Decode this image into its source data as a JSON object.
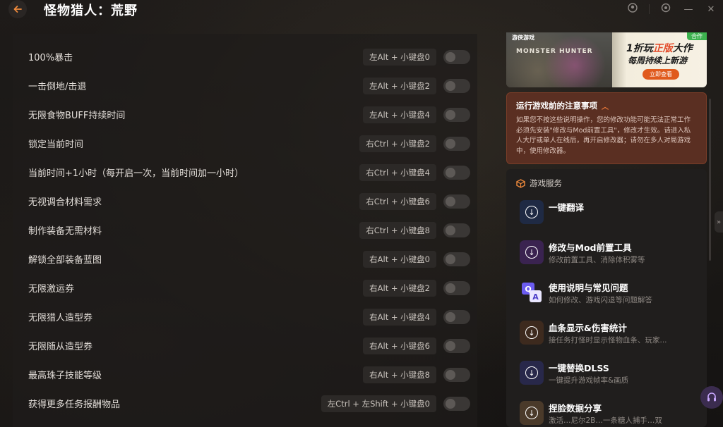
{
  "app": {
    "title": "怪物猎人：荒野"
  },
  "cheats": [
    {
      "label": "100%暴击",
      "hotkey": "左Alt + 小键盘0"
    },
    {
      "label": "一击倒地/击退",
      "hotkey": "左Alt + 小键盘2"
    },
    {
      "label": "无限食物BUFF持续时间",
      "hotkey": "左Alt + 小键盘4"
    },
    {
      "label": "锁定当前时间",
      "hotkey": "右Ctrl + 小键盘2"
    },
    {
      "label": "当前时间+1小时（每开启一次，当前时间加一小时）",
      "hotkey": "右Ctrl + 小键盘4"
    },
    {
      "label": "无视调合材料需求",
      "hotkey": "右Ctrl + 小键盘6"
    },
    {
      "label": "制作装备无需材料",
      "hotkey": "右Ctrl + 小键盘8"
    },
    {
      "label": "解锁全部装备蓝图",
      "hotkey": "右Alt + 小键盘0"
    },
    {
      "label": "无限激运券",
      "hotkey": "右Alt + 小键盘2"
    },
    {
      "label": "无限猎人造型券",
      "hotkey": "右Alt + 小键盘4"
    },
    {
      "label": "无限随从造型券",
      "hotkey": "右Alt + 小键盘6"
    },
    {
      "label": "最高珠子技能等级",
      "hotkey": "右Alt + 小键盘8"
    },
    {
      "label": "获得更多任务报酬物品",
      "hotkey": "左Ctrl + 左Shift + 小键盘0"
    }
  ],
  "banner": {
    "logo": "游侠游戏",
    "game_logo": "MONSTER HUNTER",
    "tag": "合作",
    "line1_prefix": "1折玩",
    "line1_highlight": "正版",
    "line1_suffix": "大作",
    "line2": "每周持续上新游",
    "button": "立即查看"
  },
  "notice": {
    "title": "运行游戏前的注意事项",
    "body": "如果您不按这些说明操作，您的修改功能可能无法正常工作 必须先安装\"修改与Mod前置工具\"，修改才生效。请进入私人大厅或单人在线后，再开启修改器；请勿在多人对局游戏中，使用修改器。"
  },
  "services": {
    "header": "游戏服务",
    "items": [
      {
        "title": "一键翻译",
        "subtitle": "",
        "icon": "download-icon",
        "color": "#1f2a44"
      },
      {
        "title": "修改与Mod前置工具",
        "subtitle": "修改前置工具、消除体积雾等",
        "icon": "download-icon",
        "color": "#3a2350"
      },
      {
        "title": "使用说明与常见问题",
        "subtitle": "如何修改、游戏闪退等问题解答",
        "icon": "qa-icon",
        "color": "#2b2b4a"
      },
      {
        "title": "血条显示&伤害统计",
        "subtitle": "接任务打怪时显示怪物血条、玩家...",
        "icon": "download-icon",
        "color": "#3d2a1e"
      },
      {
        "title": "一键替换DLSS",
        "subtitle": "一键提升游戏帧率&画质",
        "icon": "download-icon",
        "color": "#28284a"
      },
      {
        "title": "捏脸数据分享",
        "subtitle": "激活…尼尔2B…一条糖人捕手…双",
        "icon": "download-icon",
        "color": "#4a3a2a"
      }
    ]
  }
}
